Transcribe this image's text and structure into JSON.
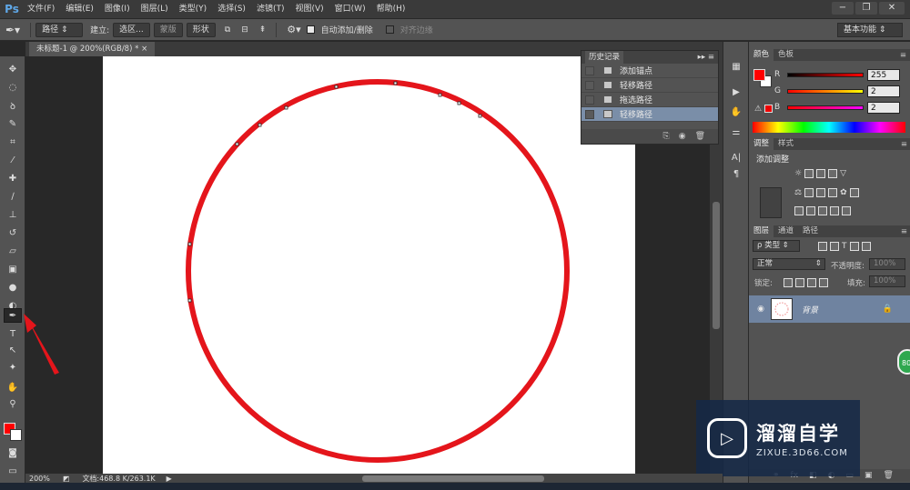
{
  "app": {
    "logo": "Ps"
  },
  "menu": [
    "文件(F)",
    "编辑(E)",
    "图像(I)",
    "图层(L)",
    "类型(Y)",
    "选择(S)",
    "滤镜(T)",
    "视图(V)",
    "窗口(W)",
    "帮助(H)"
  ],
  "options": {
    "path_mode": "路径",
    "make_label": "建立:",
    "selection_btn": "选区...",
    "mask_btn": "蒙版",
    "shape_btn": "形状",
    "auto_add_delete": "自动添加/删除",
    "align_edges": "对齐边缘",
    "workspace": "基本功能"
  },
  "document": {
    "tab_title": "未标题-1 @ 200%(RGB/8) *",
    "zoom": "200%",
    "doc_info": "文档:468.8 K/263.1K"
  },
  "history": {
    "tab": "历史记录",
    "items": [
      {
        "label": "添加锚点",
        "selected": false
      },
      {
        "label": "轻移路径",
        "selected": false
      },
      {
        "label": "拖选路径",
        "selected": false
      },
      {
        "label": "轻移路径",
        "selected": true
      }
    ]
  },
  "color_panel": {
    "tabs": [
      "颜色",
      "色板"
    ],
    "r_label": "R",
    "g_label": "G",
    "b_label": "B",
    "r": "255",
    "g": "2",
    "b": "2",
    "foreground": "#ff0000"
  },
  "adjustments": {
    "tabs": [
      "调整",
      "样式"
    ],
    "title": "添加调整"
  },
  "layers": {
    "tabs": [
      "图层",
      "通道",
      "路径"
    ],
    "filter": "ρ 类型",
    "blend_mode": "正常",
    "opacity_label": "不透明度:",
    "opacity": "100%",
    "lock_label": "锁定:",
    "fill_label": "填充:",
    "fill": "100%",
    "layer_name": "背景"
  },
  "watermark": {
    "title": "溜溜自学",
    "url": "ZIXUE.3D66.COM"
  },
  "badge": "80"
}
